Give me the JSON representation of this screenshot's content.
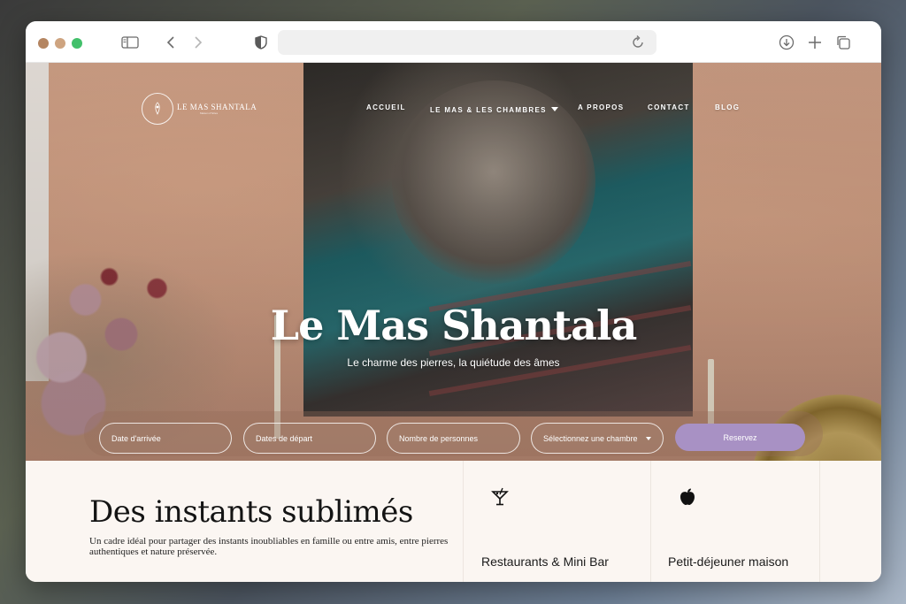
{
  "browser": {
    "url": ""
  },
  "site": {
    "logo_name": "LE MAS SHANTALA",
    "logo_tagline": "Maison d'hôtes"
  },
  "nav": {
    "items": [
      {
        "label": "ACCUEIL"
      },
      {
        "label": "LE MAS & LES CHAMBRES"
      },
      {
        "label": "A PROPOS"
      },
      {
        "label": "CONTACT"
      },
      {
        "label": "BLOG"
      }
    ]
  },
  "hero": {
    "title": "Le Mas Shantala",
    "subtitle": "Le charme des pierres, la quiétude des âmes"
  },
  "booking": {
    "arrival": "Date d'arrivée",
    "departure": "Dates de départ",
    "guests": "Nombre de personnes",
    "room": "Sélectionnez une chambre",
    "submit": "Reservez"
  },
  "section": {
    "title": "Des instants sublimés",
    "text": "Un cadre idéal pour partager des instants inoubliables en famille ou entre amis, entre pierres authentiques et nature préservée."
  },
  "features": [
    {
      "icon": "cocktail-icon",
      "label": "Restaurants & Mini Bar"
    },
    {
      "icon": "apple-icon",
      "label": "Petit-déjeuner maison"
    }
  ],
  "colors": {
    "accent": "#a891c4",
    "background": "#fbf6f2"
  }
}
